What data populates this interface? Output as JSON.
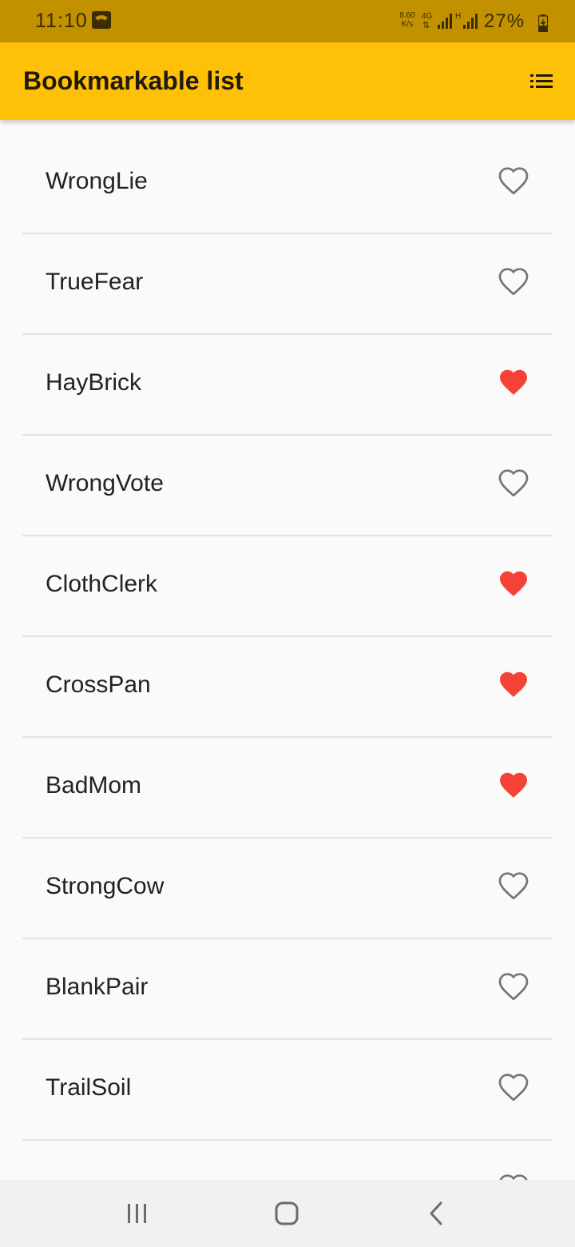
{
  "status_bar": {
    "time": "11:10",
    "net_speed_value": "8.60",
    "net_speed_unit": "K/s",
    "network_type": "4G",
    "h_label": "H",
    "battery_percent": "27%"
  },
  "app_bar": {
    "title": "Bookmarkable list",
    "background": "#ffc107",
    "action_icon": "list-icon"
  },
  "list": {
    "items": [
      {
        "label": "WrongLie",
        "bookmarked": false
      },
      {
        "label": "TrueFear",
        "bookmarked": false
      },
      {
        "label": "HayBrick",
        "bookmarked": true
      },
      {
        "label": "WrongVote",
        "bookmarked": false
      },
      {
        "label": "ClothClerk",
        "bookmarked": true
      },
      {
        "label": "CrossPan",
        "bookmarked": true
      },
      {
        "label": "BadMom",
        "bookmarked": true
      },
      {
        "label": "StrongCow",
        "bookmarked": false
      },
      {
        "label": "BlankPair",
        "bookmarked": false
      },
      {
        "label": "TrailSoil",
        "bookmarked": false
      },
      {
        "label": "",
        "bookmarked": false
      }
    ],
    "bookmarked_color": "#f44336",
    "unbookmarked_color": "#757575"
  },
  "nav_bar": {
    "recent_icon": "recent-apps-icon",
    "home_icon": "home-icon",
    "back_icon": "back-icon"
  }
}
